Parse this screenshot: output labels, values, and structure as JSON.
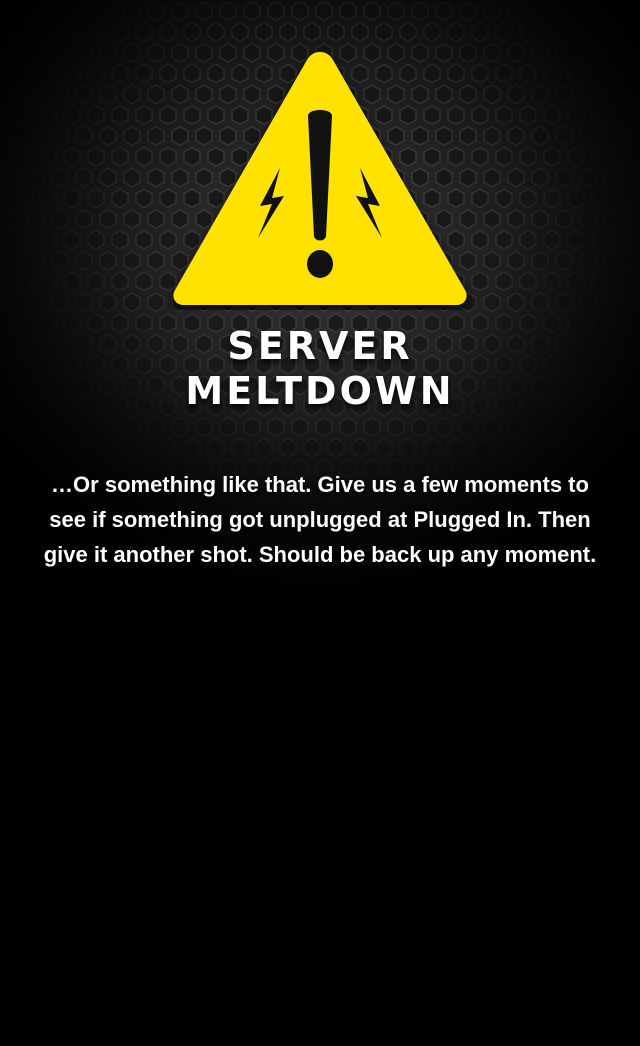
{
  "page": {
    "title_line1": "SERVER",
    "title_line2": "MELTDOWN",
    "message": "…Or something like that. Give us a few moments to see if something got unplugged at Plugged In. Then give it another shot. Should be back up any moment."
  },
  "icons": {
    "warning": "warning-triangle-icon",
    "bolt": "lightning-bolt-icon"
  },
  "colors": {
    "warning_yellow": "#FFE200",
    "text": "#FFFFFF",
    "background": "#000000"
  }
}
